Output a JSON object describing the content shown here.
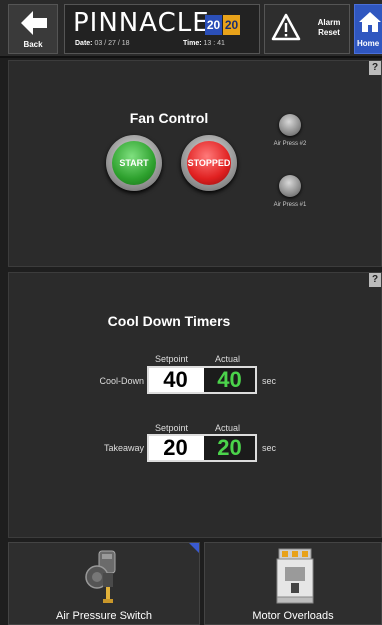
{
  "header": {
    "back_label": "Back",
    "brand": "PINNACLE",
    "year_a": "20",
    "year_b": "20",
    "date_label": "Date:",
    "date_value": "03 / 27 / 18",
    "time_label": "Time:",
    "time_value": "13 : 41",
    "alarm_label_1": "Alarm",
    "alarm_label_2": "Reset",
    "home_label": "Home"
  },
  "fan_control": {
    "title": "Fan Control",
    "help": "?",
    "start_label": "START",
    "stop_label": "STOPPED",
    "lamp_2_label": "Air Press #2",
    "lamp_1_label": "Air Press #1"
  },
  "cool_down": {
    "title": "Cool Down Timers",
    "help": "?",
    "rows": [
      {
        "label": "Cool-Down",
        "setpoint_header": "Setpoint",
        "actual_header": "Actual",
        "setpoint": "40",
        "actual": "40",
        "unit": "sec"
      },
      {
        "label": "Takeaway",
        "setpoint_header": "Setpoint",
        "actual_header": "Actual",
        "setpoint": "20",
        "actual": "20",
        "unit": "sec"
      }
    ]
  },
  "tiles": [
    {
      "label": "Air Pressure Switch",
      "icon": "air-pressure-switch-icon"
    },
    {
      "label": "Motor Overloads",
      "icon": "motor-overload-icon"
    }
  ],
  "colors": {
    "brand_year_a": "#2b4fb8",
    "brand_year_b": "#e8a21a",
    "actual_value": "#4bd34b",
    "home_button": "#2f56c0"
  }
}
